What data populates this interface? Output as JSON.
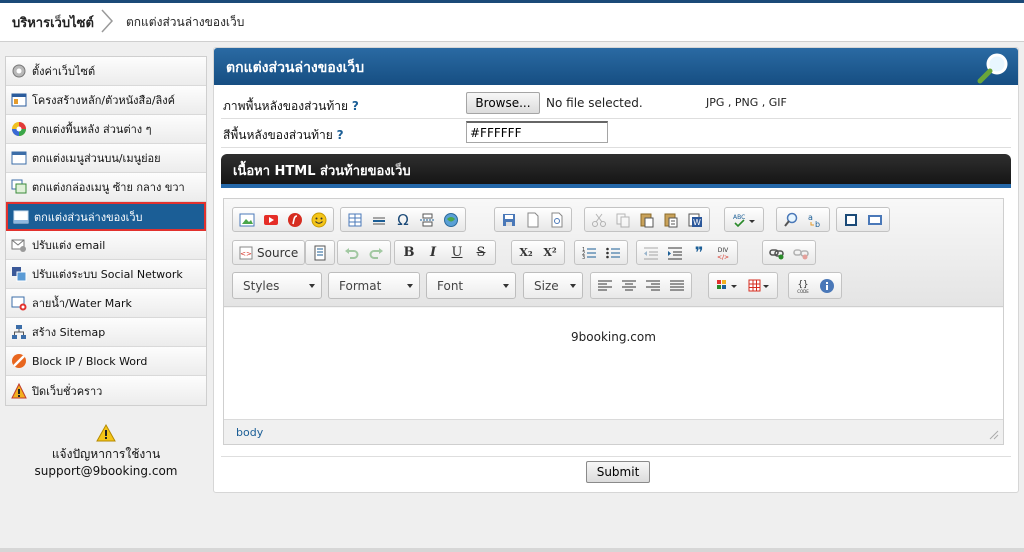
{
  "breadcrumb": {
    "root": "บริหารเว็บไซต์",
    "current": "ตกแต่งส่วนล่างของเว็บ"
  },
  "sidebar": {
    "items": [
      {
        "label": "ตั้งค่าเว็บไซต์",
        "icon": "gear-icon"
      },
      {
        "label": "โครงสร้างหลัก/ตัวหนังสือ/ลิงค์",
        "icon": "layout-icon"
      },
      {
        "label": "ตกแต่งพื้นหลัง ส่วนต่าง ๆ",
        "icon": "color-wheel-icon"
      },
      {
        "label": "ตกแต่งเมนูส่วนบน/เมนูย่อย",
        "icon": "window-icon"
      },
      {
        "label": "ตกแต่งกล่องเมนู ซ้าย กลาง ขวา",
        "icon": "windows-icon"
      },
      {
        "label": "ตกแต่งส่วนล่างของเว็บ",
        "icon": "footer-icon",
        "active": true
      },
      {
        "label": "ปรับแต่ง email",
        "icon": "email-icon"
      },
      {
        "label": "ปรับแต่งระบบ Social Network",
        "icon": "social-icon"
      },
      {
        "label": "ลายน้ำ/Water Mark",
        "icon": "watermark-icon"
      },
      {
        "label": "สร้าง Sitemap",
        "icon": "sitemap-icon"
      },
      {
        "label": "Block IP / Block Word",
        "icon": "block-icon"
      },
      {
        "label": "ปิดเว็บชั่วคราว",
        "icon": "construction-icon"
      }
    ]
  },
  "help": {
    "line1": "แจ้งปัญหาการใช้งาน",
    "line2": "support@9booking.com"
  },
  "main": {
    "title": "ตกแต่งส่วนล่างของเว็บ",
    "bg_image_label": "ภาพพื้นหลังของส่วนท้าย",
    "q_mark": "?",
    "browse_label": "Browse...",
    "no_file": "No file selected.",
    "file_types": "JPG , PNG , GIF",
    "bg_color_label": "สีพื้นหลังของส่วนท้าย",
    "bg_color_value": "#FFFFFF",
    "content_title": "เนื้อหา HTML ส่วนท้ายของเว็บ",
    "submit_label": "Submit"
  },
  "editor": {
    "source_label": "Source",
    "styles_label": "Styles",
    "format_label": "Format",
    "font_label": "Font",
    "size_label": "Size",
    "content_text": "9booking.com",
    "path_text": "body",
    "bold": "B",
    "italic": "I",
    "underline": "U",
    "strike": "S",
    "sub": "X₂",
    "sup": "X²",
    "omega": "Ω",
    "quote": "❞"
  },
  "colors": {
    "accent": "#1b5e96",
    "header_dark": "#1b1b1b",
    "active_border": "#e2322e"
  }
}
